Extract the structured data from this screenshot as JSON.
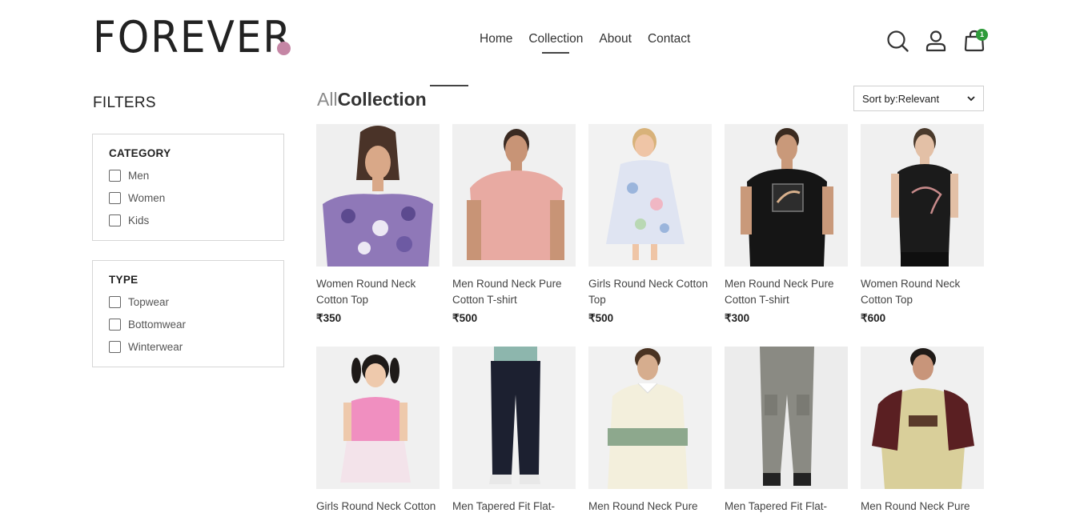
{
  "header": {
    "logo": "FOREVER",
    "nav": [
      "Home",
      "Collection",
      "About",
      "Contact"
    ],
    "active_nav": "Collection",
    "cart_count": "1",
    "colors": {
      "accent_dot": "#c586a5",
      "badge": "#2e9b3a"
    }
  },
  "filters": {
    "title": "FILTERS",
    "category": {
      "heading": "CATEGORY",
      "options": [
        "Men",
        "Women",
        "Kids"
      ]
    },
    "type": {
      "heading": "TYPE",
      "options": [
        "Topwear",
        "Bottomwear",
        "Winterwear"
      ]
    }
  },
  "collection": {
    "title_prefix": "All",
    "title_main": "Collection",
    "sort_label": "Sort by:Relevant"
  },
  "products": [
    {
      "name": "Women Round Neck Cotton Top",
      "price": "₹350"
    },
    {
      "name": "Men Round Neck Pure Cotton T-shirt",
      "price": "₹500"
    },
    {
      "name": "Girls Round Neck Cotton Top",
      "price": "₹500"
    },
    {
      "name": "Men Round Neck Pure Cotton T-shirt",
      "price": "₹300"
    },
    {
      "name": "Women Round Neck Cotton Top",
      "price": "₹600"
    },
    {
      "name": "Girls Round Neck Cotton",
      "price": ""
    },
    {
      "name": "Men Tapered Fit Flat-",
      "price": ""
    },
    {
      "name": "Men Round Neck Pure",
      "price": ""
    },
    {
      "name": "Men Tapered Fit Flat-",
      "price": ""
    },
    {
      "name": "Men Round Neck Pure",
      "price": ""
    }
  ]
}
